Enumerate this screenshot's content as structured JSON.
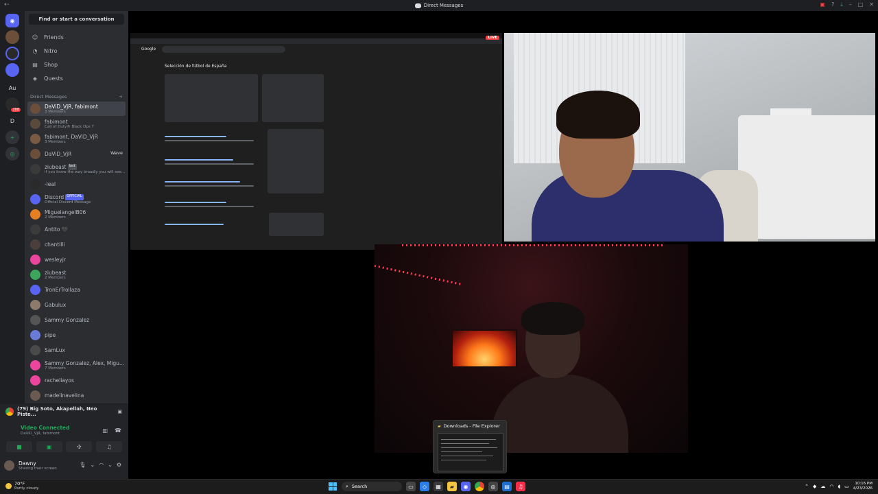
{
  "window": {
    "title": "Direct Messages"
  },
  "guild_badges": {
    "g1": "208"
  },
  "guild_labels": {
    "au": "Au",
    "d": "D"
  },
  "sidebar": {
    "search_button": "Find or start a conversation",
    "nav": [
      {
        "label": "Friends",
        "icon": "friends-icon"
      },
      {
        "label": "Nitro",
        "icon": "nitro-icon"
      },
      {
        "label": "Shop",
        "icon": "shop-icon"
      },
      {
        "label": "Quests",
        "icon": "quests-icon"
      }
    ],
    "dm_header": "Direct Messages",
    "dm_add": "+",
    "dms": [
      {
        "name": "DaViD_VjR, fabimont",
        "sub": "3 Members",
        "color": "#6b4f3a",
        "active": true
      },
      {
        "name": "fabimont",
        "sub": "Call of Duty® Black Ops 7",
        "color": "#5a4a3c"
      },
      {
        "name": "fabimont, DaViD_VjR",
        "sub": "3 Members",
        "color": "#7a5a44"
      },
      {
        "name": "DaViD_VjR",
        "sub": "",
        "color": "#6b4f3a",
        "wave": "Wave"
      },
      {
        "name": "ziubeast",
        "tag": "lost",
        "sub": "if you know the way broadly you will see it i...",
        "color": "#3a3a3a"
      },
      {
        "name": "-leal",
        "sub": "",
        "color": "#2a2a2a"
      },
      {
        "name": "Discord",
        "official": "OFFICIAL",
        "sub": "Official Discord Message",
        "color": "#5865f2"
      },
      {
        "name": "MiguelangelB06",
        "sub": "2 Members",
        "color": "#e67e22"
      },
      {
        "name": "Antito 🖤",
        "sub": "",
        "color": "#3b3b3b"
      },
      {
        "name": "chantilli",
        "sub": "",
        "color": "#4a3f3a"
      },
      {
        "name": "wesleyjr",
        "sub": "",
        "color": "#eb459e"
      },
      {
        "name": "ziubeast",
        "sub": "2 Members",
        "color": "#3ba55c"
      },
      {
        "name": "TronErTrollaza",
        "sub": "",
        "color": "#5865f2"
      },
      {
        "name": "Gabulux",
        "sub": "",
        "color": "#8c7a6b"
      },
      {
        "name": "Sammy Gonzalez",
        "sub": "",
        "color": "#555555"
      },
      {
        "name": "pipe",
        "sub": "",
        "color": "#6a7bd8"
      },
      {
        "name": "SamLux",
        "sub": "",
        "color": "#4a4a4a"
      },
      {
        "name": "Sammy Gonzalez, Alex, Miguela...",
        "sub": "7 Members",
        "color": "#eb459e"
      },
      {
        "name": "rachellayos",
        "sub": "",
        "color": "#eb459e"
      },
      {
        "name": "madelinavelina",
        "sub": "",
        "color": "#6b5a52"
      }
    ]
  },
  "panel": {
    "activity": "(79) Big Soto, Akapellah, Neo Piste...",
    "status": "Video Connected",
    "status_sub": "DaViD_VjR, fabimont",
    "user": {
      "name": "Dawny",
      "sub": "Sharing their screen"
    }
  },
  "stream": {
    "live_label": "LIVE",
    "google_logo": "Google",
    "google_title": "Selección de fútbol de España"
  },
  "downloads_popup": {
    "title": "Downloads - File Explorer"
  },
  "taskbar": {
    "weather_temp": "70°F",
    "weather_desc": "Partly cloudy",
    "search": "Search",
    "time": "10:16 PM",
    "date": "4/23/2026"
  }
}
